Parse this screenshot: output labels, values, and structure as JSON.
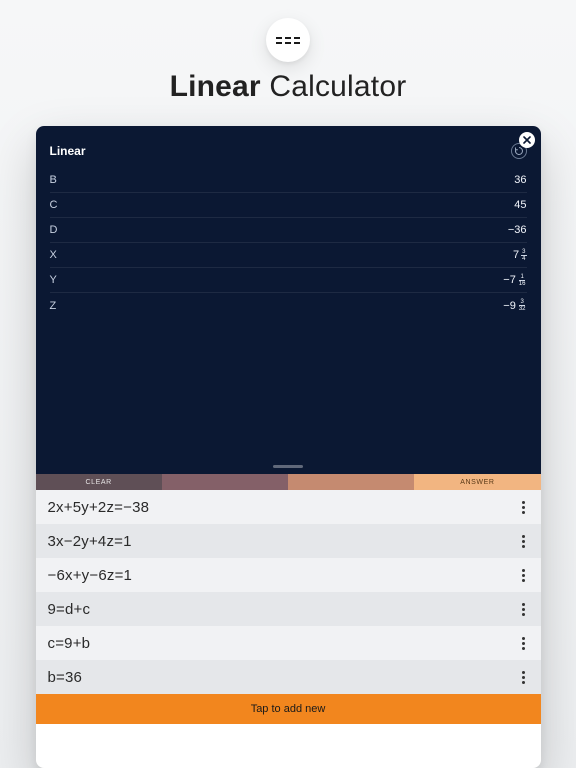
{
  "header": {
    "title_bold": "Linear",
    "title_light": " Calculator"
  },
  "panel": {
    "title": "Linear",
    "variables": [
      {
        "name": "B",
        "whole": "36",
        "num": "",
        "den": ""
      },
      {
        "name": "C",
        "whole": "45",
        "num": "",
        "den": ""
      },
      {
        "name": "D",
        "whole": "−36",
        "num": "",
        "den": ""
      },
      {
        "name": "X",
        "whole": "7",
        "num": "3",
        "den": "4"
      },
      {
        "name": "Y",
        "whole": "−7",
        "num": "1",
        "den": "16"
      },
      {
        "name": "Z",
        "whole": "−9",
        "num": "3",
        "den": "32"
      }
    ]
  },
  "actions": {
    "clear": "CLEAR",
    "answer": "ANSWER"
  },
  "equations": [
    "2x+5y+2z=−38",
    "3x−2y+4z=1",
    "−6x+y−6z=1",
    "9=d+c",
    "c=9+b",
    "b=36"
  ],
  "footer": {
    "add_label": "Tap to add new"
  },
  "icons": {
    "close": "close-icon",
    "refresh": "refresh-icon",
    "more": "more-vertical-icon",
    "badge": "dashes-icon"
  }
}
